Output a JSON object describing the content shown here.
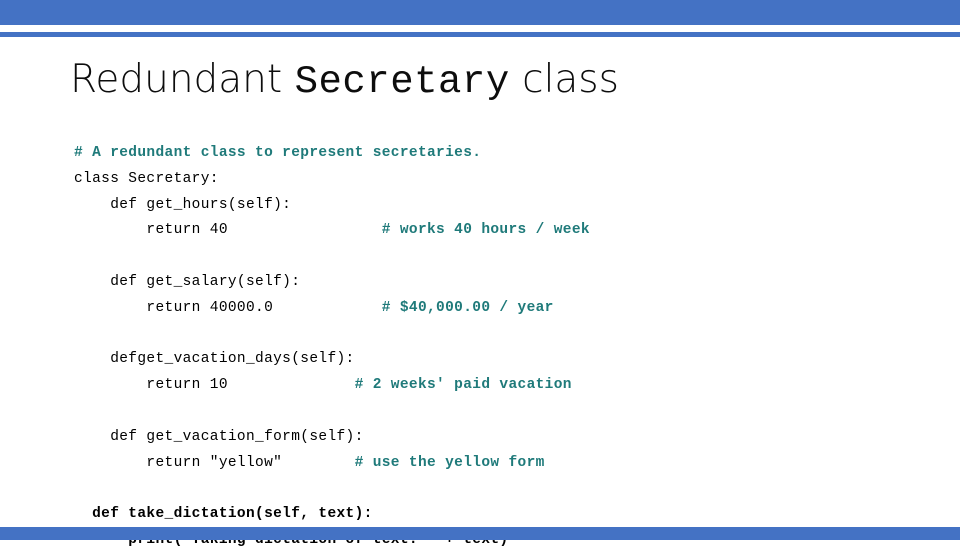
{
  "slide": {
    "title": {
      "part1": "Redundant ",
      "part2": "Secretary",
      "part3": " class"
    },
    "colors": {
      "accent_blue": "#4472c4",
      "comment_teal": "#1f7a7a",
      "code_black": "#000000",
      "background": "#ffffff"
    },
    "code_lines": [
      {
        "code": "",
        "comment": "# A redundant class to represent secretaries."
      },
      {
        "code": "class Secretary:",
        "comment": ""
      },
      {
        "code": "    def get_hours(self):",
        "comment": ""
      },
      {
        "code": "        return 40                 ",
        "comment": "# works 40 hours / week"
      },
      {
        "code": "",
        "comment": ""
      },
      {
        "code": "    def get_salary(self):",
        "comment": ""
      },
      {
        "code": "        return 40000.0            ",
        "comment": "# $40,000.00 / year"
      },
      {
        "code": "",
        "comment": ""
      },
      {
        "code": "    defget_vacation_days(self):",
        "comment": ""
      },
      {
        "code": "        return 10              ",
        "comment": "# 2 weeks' paid vacation"
      },
      {
        "code": "",
        "comment": ""
      },
      {
        "code": "    def get_vacation_form(self):",
        "comment": ""
      },
      {
        "code": "        return \"yellow\"        ",
        "comment": "# use the yellow form"
      },
      {
        "code": "",
        "comment": ""
      },
      {
        "code": "  def take_dictation(self, text):",
        "comment": "",
        "bold": true
      },
      {
        "code": "      print(\"Taking dictation of text: \" + text)",
        "comment": "",
        "bold": true
      }
    ]
  }
}
